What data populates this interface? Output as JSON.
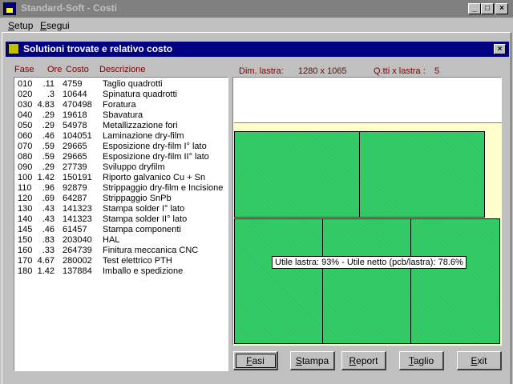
{
  "window": {
    "title": "Standard-Soft  -  Costi"
  },
  "menu": [
    {
      "prefix": "",
      "accel": "S",
      "rest": "etup"
    },
    {
      "prefix": "",
      "accel": "E",
      "rest": "segui"
    }
  ],
  "dialog": {
    "title": "Solutioni trovate e relativo costo"
  },
  "columns": {
    "fase": "Fase",
    "ore": "Ore",
    "costo": "Costo",
    "descrizione": "Descrizione"
  },
  "rows": [
    {
      "fase": "010",
      "ore": ".11",
      "costo": "4759",
      "descrizione": "Taglio quadrotti"
    },
    {
      "fase": "020",
      "ore": ".3",
      "costo": "10644",
      "descrizione": "Spinatura quadrotti"
    },
    {
      "fase": "030",
      "ore": "4.83",
      "costo": "470498",
      "descrizione": "Foratura"
    },
    {
      "fase": "040",
      "ore": ".29",
      "costo": "19618",
      "descrizione": "Sbavatura"
    },
    {
      "fase": "050",
      "ore": ".29",
      "costo": "54978",
      "descrizione": "Metallizzazione fori"
    },
    {
      "fase": "060",
      "ore": ".46",
      "costo": "104051",
      "descrizione": "Laminazione dry-film"
    },
    {
      "fase": "070",
      "ore": ".59",
      "costo": "29665",
      "descrizione": "Esposizione dry-film  I° lato"
    },
    {
      "fase": "080",
      "ore": ".59",
      "costo": "29665",
      "descrizione": "Esposizione dry-film  II° lato"
    },
    {
      "fase": "090",
      "ore": ".29",
      "costo": "27739",
      "descrizione": "Sviluppo dryfilm"
    },
    {
      "fase": "100",
      "ore": "1.42",
      "costo": "150191",
      "descrizione": "Riporto galvanico Cu + Sn"
    },
    {
      "fase": "110",
      "ore": ".96",
      "costo": "92879",
      "descrizione": "Strippaggio dry-film e Incisione"
    },
    {
      "fase": "120",
      "ore": ".69",
      "costo": "64287",
      "descrizione": "Strippaggio SnPb"
    },
    {
      "fase": "130",
      "ore": ".43",
      "costo": "141323",
      "descrizione": "Stampa solder I° lato"
    },
    {
      "fase": "140",
      "ore": ".43",
      "costo": "141323",
      "descrizione": "Stampa solder II° lato"
    },
    {
      "fase": "145",
      "ore": ".46",
      "costo": "61457",
      "descrizione": "Stampa componenti"
    },
    {
      "fase": "150",
      "ore": ".83",
      "costo": "203040",
      "descrizione": "HAL"
    },
    {
      "fase": "160",
      "ore": ".33",
      "costo": "264739",
      "descrizione": "Finitura meccanica CNC"
    },
    {
      "fase": "170",
      "ore": "4.67",
      "costo": "280002",
      "descrizione": "Test elettrico PTH"
    },
    {
      "fase": "180",
      "ore": "1.42",
      "costo": "137884",
      "descrizione": "Imballo e spedizione"
    }
  ],
  "info": {
    "dim_label": "Dim. lastra:",
    "dim_value": "1280  x 1065",
    "qty_label": "Q.tti x lastra :",
    "qty_value": "5",
    "utilization": "Utile lastra:   93%   -   Utile netto (pcb/lastra):   78.6%"
  },
  "buttons": [
    {
      "accel": "F",
      "rest": "asi"
    },
    {
      "accel": "S",
      "rest": "tampa"
    },
    {
      "accel": "R",
      "rest": "eport"
    },
    {
      "accel": "T",
      "rest": "aglio"
    },
    {
      "accel": "E",
      "rest": "xit"
    }
  ],
  "colors": {
    "title_inactive": "#808080",
    "dialog_title": "#000080",
    "pcb_fill": "#33cc66",
    "sheet_fill": "#ffffcc",
    "header_text": "#800000"
  }
}
